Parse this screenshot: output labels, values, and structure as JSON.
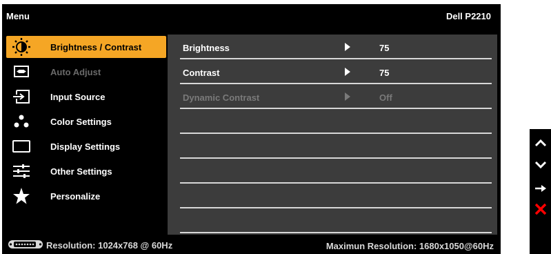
{
  "header": {
    "title": "Menu",
    "model": "Dell P2210"
  },
  "sidebar": {
    "items": [
      {
        "label": "Brightness / Contrast",
        "icon": "brightness-icon",
        "state": "active"
      },
      {
        "label": "Auto Adjust",
        "icon": "auto-adjust-icon",
        "state": "disabled"
      },
      {
        "label": "Input Source",
        "icon": "input-source-icon",
        "state": "normal"
      },
      {
        "label": "Color Settings",
        "icon": "color-settings-icon",
        "state": "normal"
      },
      {
        "label": "Display Settings",
        "icon": "display-settings-icon",
        "state": "normal"
      },
      {
        "label": "Other Settings",
        "icon": "other-settings-icon",
        "state": "normal"
      },
      {
        "label": "Personalize",
        "icon": "personalize-icon",
        "state": "normal"
      }
    ]
  },
  "panel": {
    "rows": [
      {
        "name": "Brightness",
        "value": "75",
        "state": "normal"
      },
      {
        "name": "Contrast",
        "value": "75",
        "state": "normal"
      },
      {
        "name": "Dynamic Contrast",
        "value": "Off",
        "state": "disabled"
      }
    ]
  },
  "footer": {
    "resolution": "Resolution: 1024x768 @ 60Hz",
    "max_resolution": "Maximun Resolution: 1680x1050@60Hz"
  },
  "buttons": [
    "up-arrow-icon",
    "down-arrow-icon",
    "right-arrow-icon",
    "close-icon"
  ],
  "colors": {
    "accent": "#f5a625",
    "panel": "#3c3c3c",
    "close": "#ff0000"
  }
}
